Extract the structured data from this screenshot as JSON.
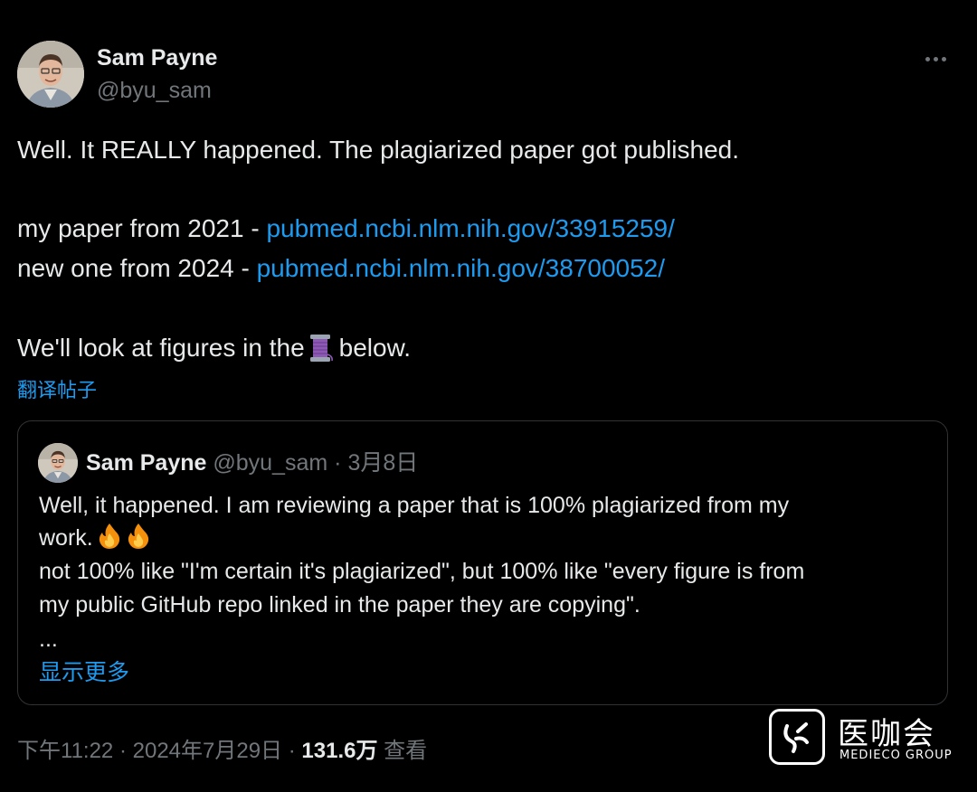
{
  "author": {
    "name": "Sam Payne",
    "handle": "@byu_sam"
  },
  "post": {
    "line1": "Well. It REALLY happened. The plagiarized paper got published.",
    "line2_prefix": "my paper from 2021 - ",
    "line2_link": "pubmed.ncbi.nlm.nih.gov/33915259/",
    "line3_prefix": "new one from 2024 - ",
    "line3_link": "pubmed.ncbi.nlm.nih.gov/38700052/",
    "line4_prefix": "We'll look at figures in the",
    "line4_emoji": "thread-spool-emoji",
    "line4_suffix": "below.",
    "translate_label": "翻译帖子"
  },
  "quote": {
    "name": "Sam Payne",
    "handle": "@byu_sam",
    "separator": "·",
    "date": "3月8日",
    "line1": "Well, it happened. I am reviewing a paper that is 100% plagiarized from my",
    "line2": "work.",
    "line2_emoji": "fire-emoji x2",
    "line3": "not 100% like \"I'm certain it's plagiarized\", but 100% like \"every figure is from",
    "line4": "my public GitHub repo linked in the paper they are copying\".",
    "line5": "...",
    "show_more_label": "显示更多"
  },
  "meta": {
    "time": "下午11:22",
    "sep1": "·",
    "date": "2024年7月29日",
    "sep2": "·",
    "views_count": "131.6万",
    "views_label": "查看"
  },
  "watermark": {
    "title": "医咖会",
    "subtitle": "MEDIECO GROUP"
  },
  "colors": {
    "background": "#000000",
    "text": "#e7e9ea",
    "secondary": "#71767b",
    "link": "#1d9bf0",
    "border": "#2f3336"
  }
}
